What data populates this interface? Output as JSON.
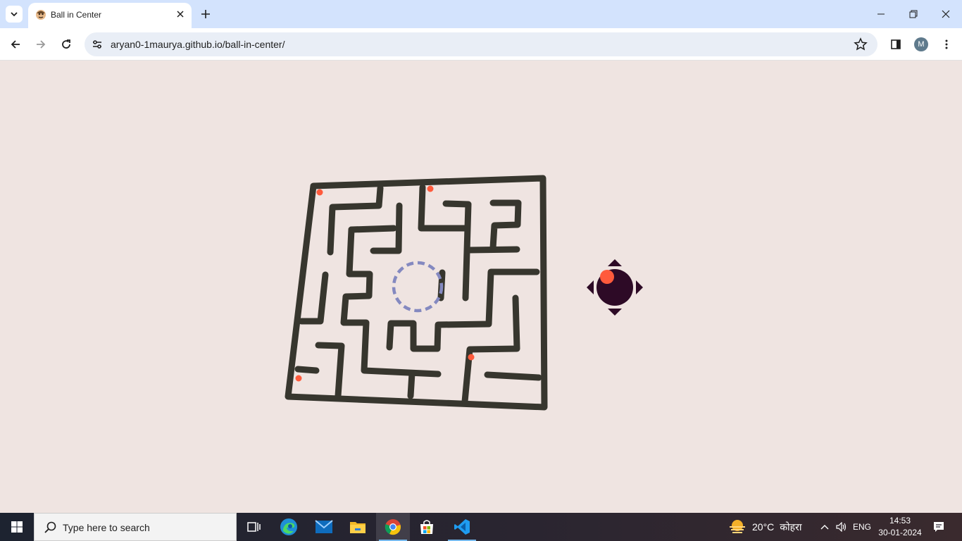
{
  "browser": {
    "tab_title": "Ball in Center",
    "url": "aryan0-1maurya.github.io/ball-in-center/",
    "profile_initial": "M"
  },
  "game": {
    "background": "#efe4e1",
    "wall_color": "#37362e",
    "ball_color": "#ff5a3c",
    "target_color": "#8489c0",
    "joystick_color": "#2d0a26"
  },
  "taskbar": {
    "search_placeholder": "Type here to search",
    "apps": [
      "task-view",
      "edge",
      "mail",
      "file-explorer",
      "chrome",
      "microsoft-store",
      "vscode"
    ],
    "weather_temp": "20°C",
    "weather_condition": "कोहरा",
    "language": "ENG",
    "time": "14:53",
    "date": "30-01-2024"
  }
}
